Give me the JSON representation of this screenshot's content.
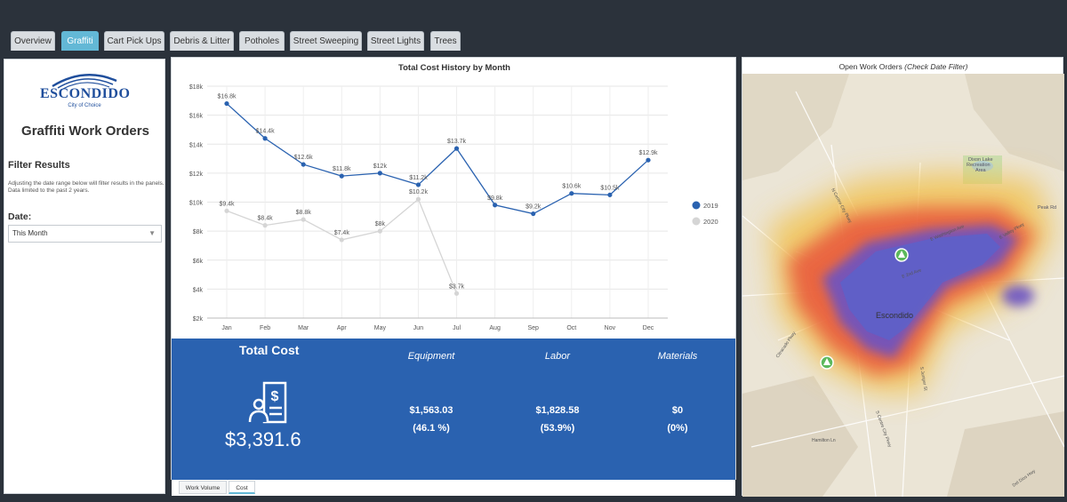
{
  "tabs": [
    {
      "label": "Overview",
      "active": false
    },
    {
      "label": "Graffiti",
      "active": true
    },
    {
      "label": "Cart Pick Ups",
      "active": false
    },
    {
      "label": "Debris & Litter",
      "active": false
    },
    {
      "label": "Potholes",
      "active": false
    },
    {
      "label": "Street Sweeping",
      "active": false
    },
    {
      "label": "Street Lights",
      "active": false
    },
    {
      "label": "Trees",
      "active": false
    }
  ],
  "sidebar": {
    "logo_text": "ESCONDIDO",
    "logo_tagline": "City of Choice",
    "title": "Graffiti Work Orders",
    "filter_title": "Filter Results",
    "filter_desc": "Adjusting the date range below will filter results in the panels. Data limited to the past 2 years.",
    "date_label": "Date:",
    "date_value": "This Month"
  },
  "chart_data": {
    "type": "line",
    "title": "Total Cost History by Month",
    "categories": [
      "Jan",
      "Feb",
      "Mar",
      "Apr",
      "May",
      "Jun",
      "Jul",
      "Aug",
      "Sep",
      "Oct",
      "Nov",
      "Dec"
    ],
    "y_ticks": [
      "$2k",
      "$4k",
      "$6k",
      "$8k",
      "$10k",
      "$12k",
      "$14k",
      "$16k",
      "$18k"
    ],
    "ylim": [
      2000,
      18000
    ],
    "grid": true,
    "legend_position": "right",
    "series": [
      {
        "name": "2019",
        "color": "#2a62b0",
        "values": [
          16800,
          14400,
          12600,
          11800,
          12000,
          11200,
          13700,
          9800,
          9200,
          10600,
          10500,
          12900
        ],
        "labels": [
          "$16.8k",
          "$14.4k",
          "$12.6k",
          "$11.8k",
          "$12k",
          "$11.2k",
          "$13.7k",
          "$9.8k",
          "$9.2k",
          "$10.6k",
          "$10.5k",
          "$12.9k"
        ]
      },
      {
        "name": "2020",
        "color": "#d5d5d5",
        "values": [
          9400,
          8400,
          8800,
          7400,
          8000,
          10200,
          3700,
          null,
          null,
          null,
          null,
          null
        ],
        "labels": [
          "$9.4k",
          "$8.4k",
          "$8.8k",
          "$7.4k",
          "$8k",
          "$10.2k",
          "$3.7k",
          "",
          "",
          "",
          "",
          ""
        ]
      }
    ]
  },
  "cost": {
    "title": "Total Cost",
    "total": "$3,391.6",
    "equipment": {
      "label": "Equipment",
      "value": "$1,563.03",
      "pct": "(46.1 %)"
    },
    "labor": {
      "label": "Labor",
      "value": "$1,828.58",
      "pct": "(53.9%)"
    },
    "materials": {
      "label": "Materials",
      "value": "$0",
      "pct": "(0%)"
    }
  },
  "bottom_tabs": [
    {
      "label": "Work Volume",
      "active": false
    },
    {
      "label": "Cost",
      "active": true
    }
  ],
  "map": {
    "title": "Open Work Orders",
    "title_note": "(Check Date Filter)",
    "city_label": "Escondido",
    "lake_label": "Dixon Lake Recreation Area",
    "peak_label": "Peak Rd",
    "roads": [
      "E Washington Ave",
      "E Valley Pkwy",
      "N Centre City Pkwy",
      "Citracado Pkwy",
      "S Centre City Pkwy",
      "Hamilton Ln",
      "Del Dios Hwy",
      "S Juniper St",
      "N Broadway",
      "E 2nd Ave"
    ],
    "pins": 2
  }
}
